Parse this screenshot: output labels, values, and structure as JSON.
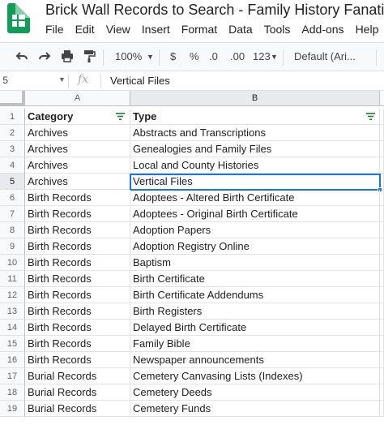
{
  "doc_title": "Brick Wall Records to Search - Family History Fanatics",
  "menu": [
    "File",
    "Edit",
    "View",
    "Insert",
    "Format",
    "Data",
    "Tools",
    "Add-ons",
    "Help"
  ],
  "toolbar": {
    "zoom": "100%",
    "currency": "$",
    "percent": "%",
    "decrease_decimal": ".0",
    "increase_decimal": ".00",
    "number_format": "123",
    "font": "Default (Ari..."
  },
  "formula_bar": {
    "name_box": " 5",
    "fx": "fx",
    "value": "Vertical Files"
  },
  "columns": [
    "A",
    "B"
  ],
  "rows": [
    {
      "num": "1",
      "a": "Category",
      "b": "Type"
    },
    {
      "num": "2",
      "a": "Archives",
      "b": "Abstracts and Transcriptions"
    },
    {
      "num": "3",
      "a": "Archives",
      "b": "Genealogies and Family Files"
    },
    {
      "num": "4",
      "a": "Archives",
      "b": "Local and County Histories"
    },
    {
      "num": "5",
      "a": "Archives",
      "b": "Vertical Files"
    },
    {
      "num": "6",
      "a": "Birth Records",
      "b": "Adoptees - Altered Birth Certificate"
    },
    {
      "num": "7",
      "a": "Birth Records",
      "b": "Adoptees - Original Birth Certificate"
    },
    {
      "num": "8",
      "a": "Birth Records",
      "b": "Adoption Papers"
    },
    {
      "num": "9",
      "a": "Birth Records",
      "b": "Adoption Registry Online"
    },
    {
      "num": "10",
      "a": "Birth Records",
      "b": "Baptism"
    },
    {
      "num": "11",
      "a": "Birth Records",
      "b": "Birth Certificate"
    },
    {
      "num": "12",
      "a": "Birth Records",
      "b": "Birth Certificate Addendums"
    },
    {
      "num": "13",
      "a": "Birth Records",
      "b": "Birth Registers"
    },
    {
      "num": "14",
      "a": "Birth Records",
      "b": "Delayed Birth Certificate"
    },
    {
      "num": "15",
      "a": "Birth Records",
      "b": "Family Bible"
    },
    {
      "num": "16",
      "a": "Birth Records",
      "b": "Newspaper announcements"
    },
    {
      "num": "17",
      "a": "Burial Records",
      "b": "Cemetery Canvasing Lists (Indexes)"
    },
    {
      "num": "18",
      "a": "Burial Records",
      "b": "Cemetery Deeds"
    },
    {
      "num": "19",
      "a": "Burial Records",
      "b": "Cemetery Funds"
    }
  ],
  "colors": {
    "brand_green": "#0f9d58",
    "selection_blue": "#1a73e8",
    "header_bg": "#f8f9fa"
  }
}
